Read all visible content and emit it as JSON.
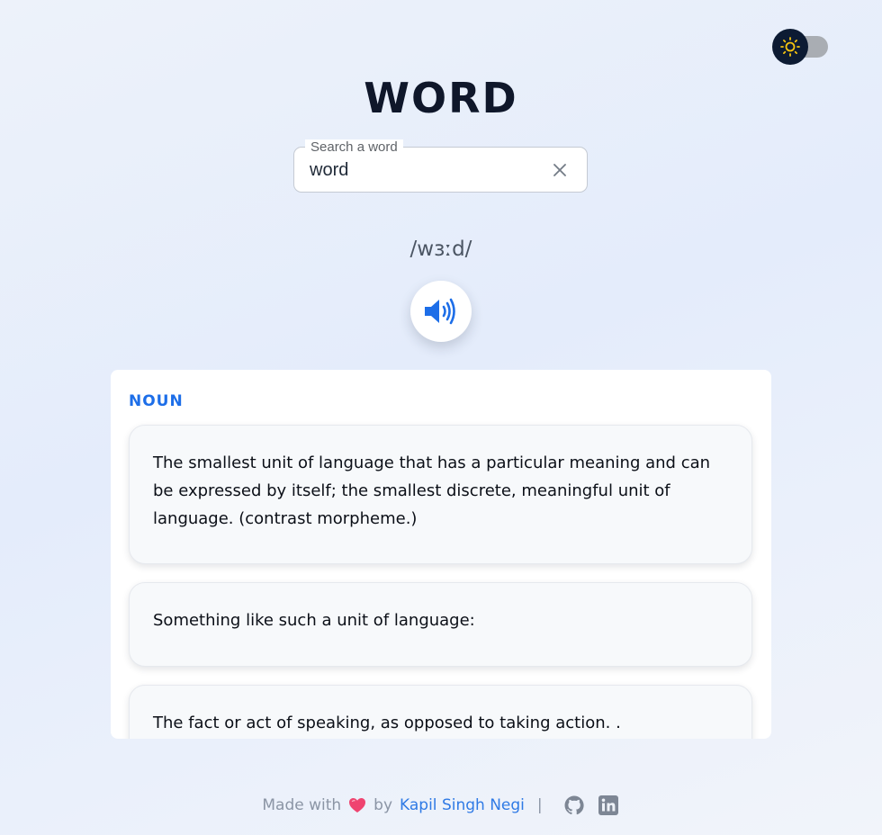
{
  "header": {
    "title": "WORD"
  },
  "theme_toggle": {
    "icon": "sun-icon",
    "mode": "dark"
  },
  "search": {
    "label": "Search a word",
    "value": "word",
    "clear_icon": "close-icon"
  },
  "pronunciation": {
    "phonetic": "/wɜːd/",
    "audio_icon": "speaker-icon"
  },
  "meanings": [
    {
      "part_of_speech": "NOUN",
      "definitions": [
        "The smallest unit of language that has a particular meaning and can be expressed by itself; the smallest discrete, meaningful unit of language. (contrast morpheme.)",
        "Something like such a unit of language:",
        "The fact or act of speaking, as opposed to taking action. ."
      ]
    }
  ],
  "footer": {
    "made_with": "Made with",
    "heart": "♥",
    "by": "by",
    "author": "Kapil Singh Negi",
    "separator": "|",
    "links": [
      "github-icon",
      "linkedin-icon"
    ]
  },
  "colors": {
    "accent": "#1d6ee8",
    "title": "#0f172a",
    "heart": "#ef4470"
  }
}
